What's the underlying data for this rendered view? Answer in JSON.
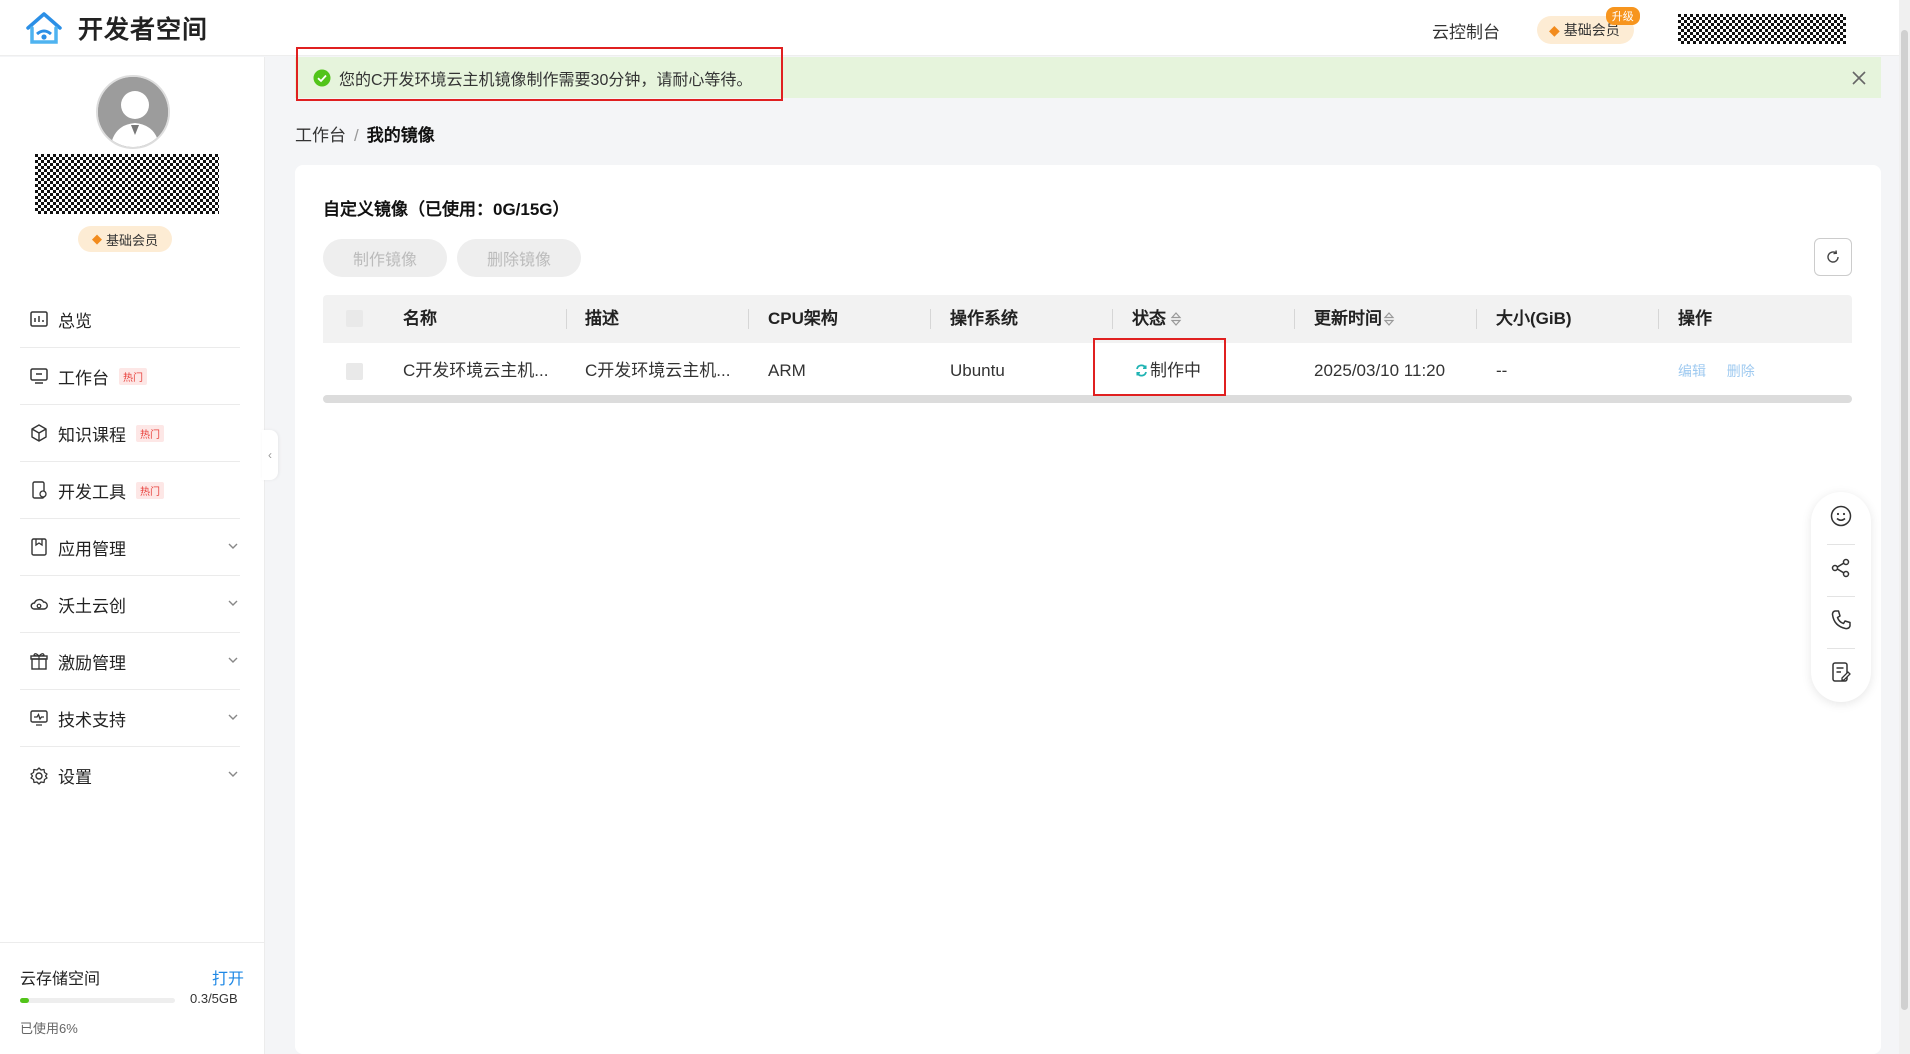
{
  "header": {
    "app_title": "开发者空间",
    "console_link": "云控制台",
    "member_badge": "基础会员",
    "upgrade_tag": "升级"
  },
  "sidebar": {
    "member_badge": "基础会员",
    "items": [
      {
        "label": "总览",
        "icon": "overview-icon"
      },
      {
        "label": "工作台",
        "icon": "workbench-icon",
        "tag": "热门"
      },
      {
        "label": "知识课程",
        "icon": "course-icon",
        "tag": "热门"
      },
      {
        "label": "开发工具",
        "icon": "devtool-icon",
        "tag": "热门"
      },
      {
        "label": "应用管理",
        "icon": "app-manage-icon"
      },
      {
        "label": "沃土云创",
        "icon": "cloud-create-icon"
      },
      {
        "label": "激励管理",
        "icon": "gift-icon"
      },
      {
        "label": "技术支持",
        "icon": "support-icon"
      },
      {
        "label": "设置",
        "icon": "gear-icon"
      }
    ],
    "storage": {
      "title": "云存储空间",
      "open_link": "打开",
      "quota": "0.3/5GB",
      "used_text": "已使用6%",
      "used_fraction": 0.06
    }
  },
  "notice": {
    "text": "您的C开发环境云主机镜像制作需要30分钟，请耐心等待。"
  },
  "breadcrumb": {
    "root": "工作台",
    "separator": "/",
    "current": "我的镜像"
  },
  "card": {
    "title": "自定义镜像（已使用：0G/15G）",
    "create_button": "制作镜像",
    "delete_button": "删除镜像"
  },
  "table": {
    "columns": [
      "名称",
      "描述",
      "CPU架构",
      "操作系统",
      "状态",
      "更新时间",
      "大小(GiB)",
      "操作"
    ],
    "rows": [
      {
        "name": "C开发环境云主机...",
        "description": "C开发环境云主机...",
        "cpu": "ARM",
        "os": "Ubuntu",
        "status": "制作中",
        "updated": "2025/03/10 11:20",
        "size": "--",
        "actions": [
          "编辑",
          "删除"
        ]
      }
    ]
  },
  "colors": {
    "accent": "#1e88e5",
    "notice_bg": "#e6f4dc",
    "success": "#52c41a",
    "status_icon": "#1fb3b3",
    "highlight": "#e02020",
    "hot_tag": "#e8413c",
    "member_bg": "#fdecd4"
  }
}
